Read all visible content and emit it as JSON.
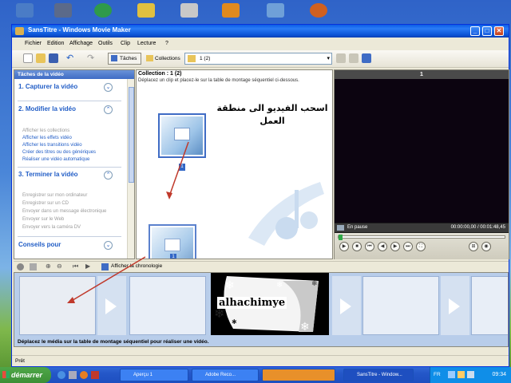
{
  "window": {
    "title": "SansTitre - Windows Movie Maker",
    "controls": [
      "_",
      "□",
      "✕"
    ]
  },
  "menu": [
    "Fichier",
    "Edition",
    "Affichage",
    "Outils",
    "Clip",
    "Lecture",
    "?"
  ],
  "toolbar": {
    "tasks_label": "Tâches",
    "collections_label": "Collections",
    "collection_value": "1 (2)"
  },
  "taskpane": {
    "header": "Tâches de la vidéo",
    "sections": [
      {
        "title": "1. Capturer la vidéo",
        "links": []
      },
      {
        "title": "2. Modifier la vidéo",
        "links": [
          {
            "label": "Afficher les collections",
            "enabled": false
          },
          {
            "label": "Afficher les effets vidéo",
            "enabled": true
          },
          {
            "label": "Afficher les transitions vidéo",
            "enabled": true
          },
          {
            "label": "Créer des titres ou des génériques",
            "enabled": true
          },
          {
            "label": "Réaliser une vidéo automatique",
            "enabled": true
          }
        ]
      },
      {
        "title": "3. Terminer la vidéo",
        "links": [
          {
            "label": "Enregistrer sur mon ordinateur",
            "enabled": false
          },
          {
            "label": "Enregistrer sur un CD",
            "enabled": false
          },
          {
            "label": "Envoyer dans un message électronique",
            "enabled": false
          },
          {
            "label": "Envoyer sur le Web",
            "enabled": false
          },
          {
            "label": "Envoyer vers la caméra DV",
            "enabled": false
          }
        ]
      },
      {
        "title": "Conseils pour",
        "links": []
      }
    ]
  },
  "collection": {
    "title": "Collection : 1 (2)",
    "subtitle": "Déplacez un clip et placez-le sur la table de montage séquentiel ci-dessous.",
    "clips": [
      "1",
      "1"
    ],
    "annotation": "اسحب الفيديو الى منطقة العمل"
  },
  "preview": {
    "header": "1",
    "status": "En pause",
    "time": "00:00:00,00 / 00:01:48,45"
  },
  "storyboard": {
    "timeline_label": "Afficher la chronologie",
    "clip_text": "alhachimye",
    "message": "Déplacez le média sur la table de montage séquentiel pour réaliser une vidéo."
  },
  "statusbar": {
    "text": "Prêt"
  },
  "taskbar": {
    "start_label": "démarrer",
    "tasks": [
      "Aperçu 1",
      "Adobe Reco...",
      "",
      "SansTitre - Window..."
    ],
    "language": "FR",
    "clock": "09:34"
  },
  "colors": {
    "accent": "#215dc6",
    "title_bar": "#0a5ce8",
    "storyboard_bg": "#b8cdea",
    "annotation_arrow": "#c0392b"
  }
}
